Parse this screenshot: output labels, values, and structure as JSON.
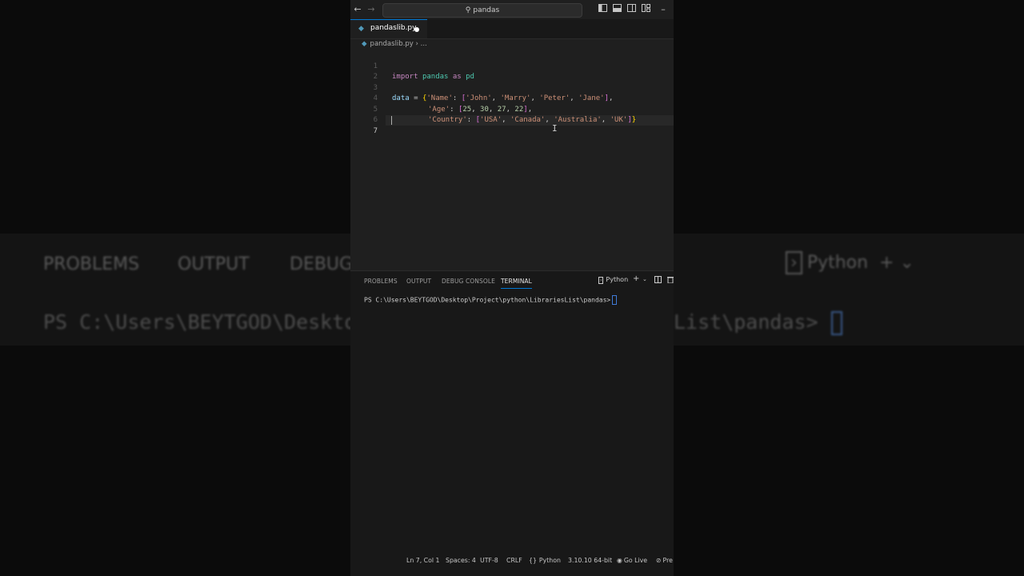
{
  "background_echo": {
    "tabs": [
      "PROBLEMS",
      "OUTPUT",
      "DEBUG"
    ],
    "python": "Python",
    "term_left": "PS C:\\Users\\BEYTGOD\\Deskto",
    "term_right": "List\\pandas>"
  },
  "titlebar": {
    "search_text": "pandas"
  },
  "tab": {
    "filename": "pandaslib.py"
  },
  "breadcrumb": {
    "file": "pandaslib.py",
    "sep": "› ..."
  },
  "editor": {
    "line_numbers": [
      "1",
      "2",
      "3",
      "4",
      "5",
      "6",
      "7"
    ],
    "line1": {
      "kw": "import",
      "mod": "pandas",
      "as": "as",
      "alias": "pd"
    },
    "line3": {
      "var": "data",
      "op": " = ",
      "open": "{",
      "k1": "'Name'",
      "colon": ": ",
      "lb": "[",
      "v1": "'John'",
      "v2": "'Marry'",
      "v3": "'Peter'",
      "v4": "'Jane'",
      "rb": "]",
      "comma": ","
    },
    "line4": {
      "k": "'Age'",
      "colon": ": ",
      "lb": "[",
      "n1": "25",
      "n2": "30",
      "n3": "27",
      "n4": "22",
      "rb": "]",
      "comma": ","
    },
    "line5": {
      "k": "'Country'",
      "colon": ": ",
      "lb": "[",
      "v1": "'USA'",
      "v2": "'Canada'",
      "v3": "'Australia'",
      "v4": "'UK'",
      "rb": "]",
      "close": "}"
    }
  },
  "panel": {
    "tabs": [
      "PROBLEMS",
      "OUTPUT",
      "DEBUG CONSOLE",
      "TERMINAL"
    ],
    "active_tab": "TERMINAL",
    "shell": "Python",
    "prompt": "PS C:\\Users\\BEYTGOD\\Desktop\\Project\\python\\LibrariesList\\pandas>"
  },
  "statusbar": {
    "position": "Ln 7, Col 1",
    "spaces": "Spaces: 4",
    "encoding": "UTF-8",
    "eol": "CRLF",
    "language": "Python",
    "interpreter": "3.10.10 64-bit",
    "golive": "Go Live",
    "prettier": "Pre"
  },
  "colors": {
    "accent": "#0078d4",
    "keyword": "#c586c0",
    "string": "#ce9178",
    "number": "#b5cea8",
    "variable": "#9cdcfe"
  }
}
